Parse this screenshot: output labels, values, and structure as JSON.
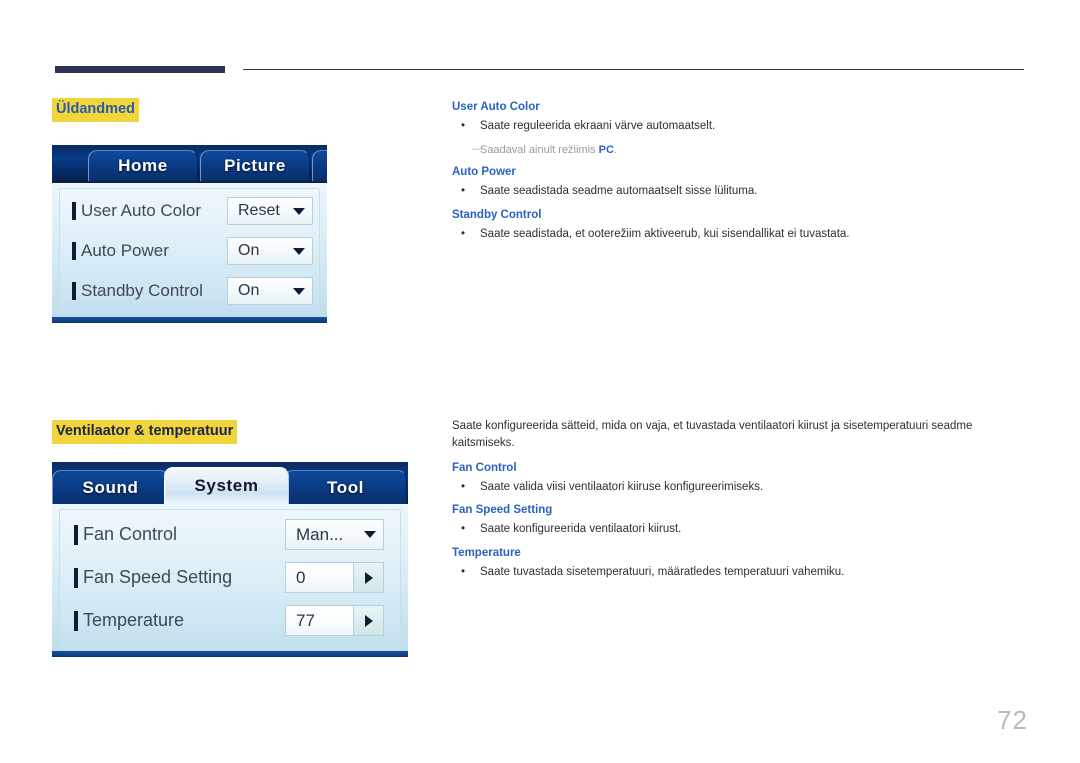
{
  "page": {
    "number": "72"
  },
  "sections": [
    {
      "heading": "Üldandmed",
      "osd": {
        "tabs": [
          {
            "label": "Home",
            "state": "inactive"
          },
          {
            "label": "Picture",
            "state": "inactive"
          },
          {
            "label": "",
            "state": "inactive"
          }
        ],
        "rows": [
          {
            "label": "User Auto Color",
            "value": "Reset",
            "control": "dropdown"
          },
          {
            "label": "Auto Power",
            "value": "On",
            "control": "dropdown"
          },
          {
            "label": "Standby Control",
            "value": "On",
            "control": "dropdown"
          }
        ]
      },
      "text": {
        "intro": "",
        "items": [
          {
            "term": "User Auto Color",
            "bullets": [
              "Saate reguleerida ekraani värve automaatselt."
            ],
            "note": {
              "prefix": "Saadaval ainult režiimis ",
              "bold": "PC",
              "suffix": "."
            }
          },
          {
            "term": "Auto Power",
            "bullets": [
              "Saate seadistada seadme automaatselt sisse lülituma."
            ],
            "note": null
          },
          {
            "term": "Standby Control",
            "bullets": [
              "Saate seadistada, et ooterežiim aktiveerub, kui sisendallikat ei tuvastata."
            ],
            "note": null
          }
        ]
      }
    },
    {
      "heading": "Ventilaator & temperatuur",
      "osd": {
        "tabs": [
          {
            "label": "Sound",
            "state": "inactive"
          },
          {
            "label": "System",
            "state": "active"
          },
          {
            "label": "Tool",
            "state": "inactive"
          }
        ],
        "rows": [
          {
            "label": "Fan Control",
            "value": "Man...",
            "control": "dropdown"
          },
          {
            "label": "Fan Speed Setting",
            "value": "0",
            "control": "stepper"
          },
          {
            "label": "Temperature",
            "value": "77",
            "control": "stepper"
          }
        ]
      },
      "text": {
        "intro": "Saate konfigureerida sätteid, mida on vaja, et tuvastada ventilaatori kiirust ja sisetemperatuuri seadme kaitsmiseks.",
        "items": [
          {
            "term": "Fan Control",
            "bullets": [
              "Saate valida viisi ventilaatori kiiruse konfigureerimiseks."
            ],
            "note": null
          },
          {
            "term": "Fan Speed Setting",
            "bullets": [
              "Saate konfigureerida ventilaatori kiirust."
            ],
            "note": null
          },
          {
            "term": "Temperature",
            "bullets": [
              "Saate tuvastada sisetemperatuuri, määratledes temperatuuri vahemiku."
            ],
            "note": null
          }
        ]
      }
    }
  ],
  "colors": {
    "heading_highlight": "#f0d53c",
    "heading_blue": "#2a5caa",
    "term_blue": "#2a63c0",
    "rule_navy": "#2e3255",
    "page_number_gray": "#b9b9bd"
  }
}
